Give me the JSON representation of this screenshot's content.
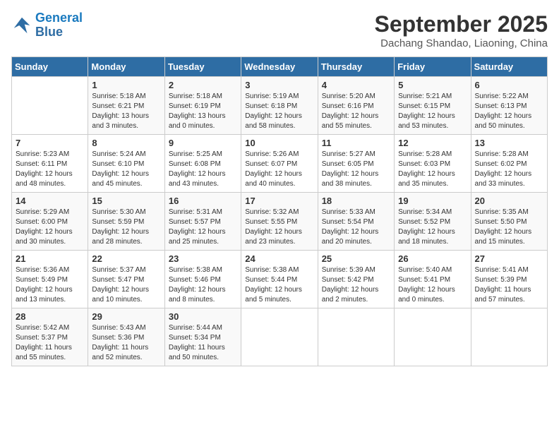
{
  "header": {
    "logo_line1": "General",
    "logo_line2": "Blue",
    "month": "September 2025",
    "location": "Dachang Shandao, Liaoning, China"
  },
  "weekdays": [
    "Sunday",
    "Monday",
    "Tuesday",
    "Wednesday",
    "Thursday",
    "Friday",
    "Saturday"
  ],
  "weeks": [
    [
      null,
      {
        "day": 1,
        "sunrise": "5:18 AM",
        "sunset": "6:21 PM",
        "daylight": "13 hours and 3 minutes."
      },
      {
        "day": 2,
        "sunrise": "5:18 AM",
        "sunset": "6:19 PM",
        "daylight": "13 hours and 0 minutes."
      },
      {
        "day": 3,
        "sunrise": "5:19 AM",
        "sunset": "6:18 PM",
        "daylight": "12 hours and 58 minutes."
      },
      {
        "day": 4,
        "sunrise": "5:20 AM",
        "sunset": "6:16 PM",
        "daylight": "12 hours and 55 minutes."
      },
      {
        "day": 5,
        "sunrise": "5:21 AM",
        "sunset": "6:15 PM",
        "daylight": "12 hours and 53 minutes."
      },
      {
        "day": 6,
        "sunrise": "5:22 AM",
        "sunset": "6:13 PM",
        "daylight": "12 hours and 50 minutes."
      }
    ],
    [
      {
        "day": 7,
        "sunrise": "5:23 AM",
        "sunset": "6:11 PM",
        "daylight": "12 hours and 48 minutes."
      },
      {
        "day": 8,
        "sunrise": "5:24 AM",
        "sunset": "6:10 PM",
        "daylight": "12 hours and 45 minutes."
      },
      {
        "day": 9,
        "sunrise": "5:25 AM",
        "sunset": "6:08 PM",
        "daylight": "12 hours and 43 minutes."
      },
      {
        "day": 10,
        "sunrise": "5:26 AM",
        "sunset": "6:07 PM",
        "daylight": "12 hours and 40 minutes."
      },
      {
        "day": 11,
        "sunrise": "5:27 AM",
        "sunset": "6:05 PM",
        "daylight": "12 hours and 38 minutes."
      },
      {
        "day": 12,
        "sunrise": "5:28 AM",
        "sunset": "6:03 PM",
        "daylight": "12 hours and 35 minutes."
      },
      {
        "day": 13,
        "sunrise": "5:28 AM",
        "sunset": "6:02 PM",
        "daylight": "12 hours and 33 minutes."
      }
    ],
    [
      {
        "day": 14,
        "sunrise": "5:29 AM",
        "sunset": "6:00 PM",
        "daylight": "12 hours and 30 minutes."
      },
      {
        "day": 15,
        "sunrise": "5:30 AM",
        "sunset": "5:59 PM",
        "daylight": "12 hours and 28 minutes."
      },
      {
        "day": 16,
        "sunrise": "5:31 AM",
        "sunset": "5:57 PM",
        "daylight": "12 hours and 25 minutes."
      },
      {
        "day": 17,
        "sunrise": "5:32 AM",
        "sunset": "5:55 PM",
        "daylight": "12 hours and 23 minutes."
      },
      {
        "day": 18,
        "sunrise": "5:33 AM",
        "sunset": "5:54 PM",
        "daylight": "12 hours and 20 minutes."
      },
      {
        "day": 19,
        "sunrise": "5:34 AM",
        "sunset": "5:52 PM",
        "daylight": "12 hours and 18 minutes."
      },
      {
        "day": 20,
        "sunrise": "5:35 AM",
        "sunset": "5:50 PM",
        "daylight": "12 hours and 15 minutes."
      }
    ],
    [
      {
        "day": 21,
        "sunrise": "5:36 AM",
        "sunset": "5:49 PM",
        "daylight": "12 hours and 13 minutes."
      },
      {
        "day": 22,
        "sunrise": "5:37 AM",
        "sunset": "5:47 PM",
        "daylight": "12 hours and 10 minutes."
      },
      {
        "day": 23,
        "sunrise": "5:38 AM",
        "sunset": "5:46 PM",
        "daylight": "12 hours and 8 minutes."
      },
      {
        "day": 24,
        "sunrise": "5:38 AM",
        "sunset": "5:44 PM",
        "daylight": "12 hours and 5 minutes."
      },
      {
        "day": 25,
        "sunrise": "5:39 AM",
        "sunset": "5:42 PM",
        "daylight": "12 hours and 2 minutes."
      },
      {
        "day": 26,
        "sunrise": "5:40 AM",
        "sunset": "5:41 PM",
        "daylight": "12 hours and 0 minutes."
      },
      {
        "day": 27,
        "sunrise": "5:41 AM",
        "sunset": "5:39 PM",
        "daylight": "11 hours and 57 minutes."
      }
    ],
    [
      {
        "day": 28,
        "sunrise": "5:42 AM",
        "sunset": "5:37 PM",
        "daylight": "11 hours and 55 minutes."
      },
      {
        "day": 29,
        "sunrise": "5:43 AM",
        "sunset": "5:36 PM",
        "daylight": "11 hours and 52 minutes."
      },
      {
        "day": 30,
        "sunrise": "5:44 AM",
        "sunset": "5:34 PM",
        "daylight": "11 hours and 50 minutes."
      },
      null,
      null,
      null,
      null
    ]
  ]
}
